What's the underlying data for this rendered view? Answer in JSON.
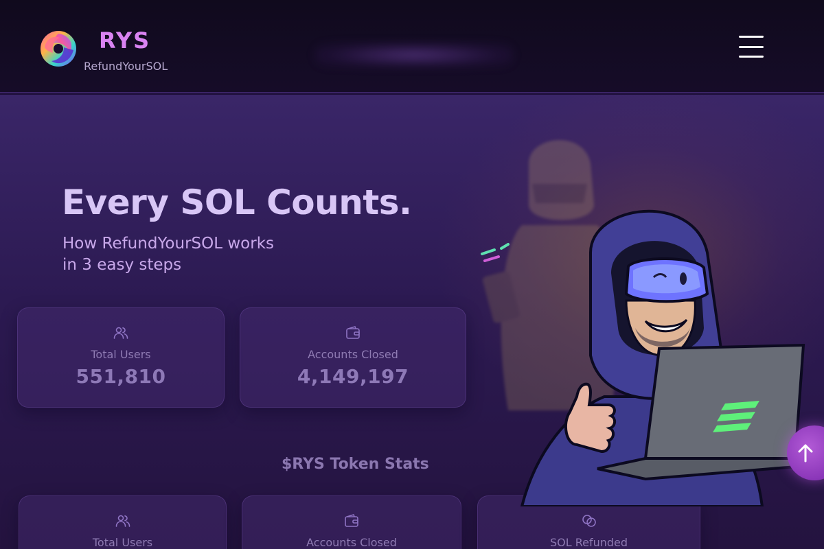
{
  "header": {
    "brand_name": "RYS",
    "brand_tagline": "RefundYourSOL",
    "menu_icon": "hamburger-menu-icon"
  },
  "hero": {
    "title": "Every SOL Counts.",
    "subtitle_line1": "How RefundYourSOL works",
    "subtitle_line2": "in 3 easy steps"
  },
  "stats": [
    {
      "icon": "users-icon",
      "label": "Total Users",
      "value": "551,810"
    },
    {
      "icon": "wallet-icon",
      "label": "Accounts Closed",
      "value": "4,149,197"
    }
  ],
  "token_stats": {
    "title": "$RYS Token Stats",
    "cards": [
      {
        "icon": "users-icon",
        "label": "Total Users"
      },
      {
        "icon": "wallet-icon",
        "label": "Accounts Closed"
      },
      {
        "icon": "coins-icon",
        "label": "SOL Refunded"
      }
    ]
  },
  "scroll_top": {
    "icon": "arrow-up-icon"
  },
  "colors": {
    "brand": "#d983f2",
    "background": "#2c1a52",
    "header_background": "#120b20",
    "accent_button": "#9a45c6",
    "solana_green": "#5ef07a"
  }
}
